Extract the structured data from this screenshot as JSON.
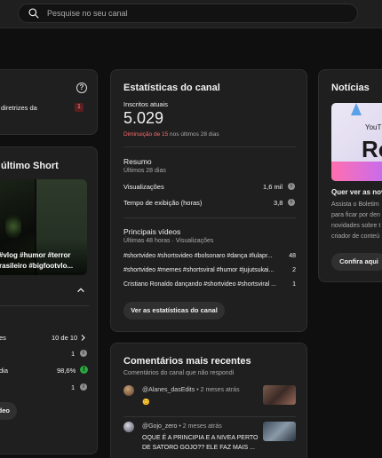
{
  "search": {
    "placeholder": "Pesquise no seu canal"
  },
  "left": {
    "policy_text": "diretrizes da",
    "policy_count": "1",
    "short_heading": "último Short",
    "short_caption_1": "#vlog #humor #terror",
    "short_caption_2": "rasileiro #bigfootvlo...",
    "stats": [
      {
        "label": "es",
        "value": "10 de 10"
      },
      {
        "label": "",
        "value": "1"
      },
      {
        "label": "dia",
        "value": "98,6%"
      },
      {
        "label": "",
        "value": "1"
      }
    ],
    "button": "deo"
  },
  "analytics": {
    "title": "Estatísticas do canal",
    "subs_label": "Inscritos atuais",
    "subs_value": "5.029",
    "decrease_prefix": "Diminuição de",
    "decrease_value": "15",
    "decrease_suffix": "nos últimos 28 dias",
    "summary_title": "Resumo",
    "summary_period": "Últimos 28 dias",
    "rows": [
      {
        "label": "Visualizações",
        "value": "1,6 mil"
      },
      {
        "label": "Tempo de exibição (horas)",
        "value": "3,8"
      }
    ],
    "top_title": "Principais vídeos",
    "top_period": "Últimas 48 horas · Visualizações",
    "videos": [
      {
        "title": "#shortvideo #shortsvideo #bolsonaro #dança #lulapr...",
        "views": "48"
      },
      {
        "title": "#shortvideo #memes #shortsviral #humor #jujutsukai...",
        "views": "2"
      },
      {
        "title": "Cristiano Ronaldo dançando #shortvideo #shortsviral ...",
        "views": "1"
      }
    ],
    "button": "Ver as estatísticas do canal"
  },
  "comments": {
    "title": "Comentários mais recentes",
    "subtitle": "Comentários do canal que não respondi",
    "items": [
      {
        "author": "@Alanes_dasEdits",
        "time": "• 2 meses atrás",
        "text": "😊",
        "text2": ""
      },
      {
        "author": "@Gojo_zero",
        "time": "• 2 meses atrás",
        "text": "OQUE É A PRINCIPIA E A NIVEA PERTO",
        "text2": "DE SATORO GOJO?? ELE FAZ MAIS ..."
      }
    ]
  },
  "news": {
    "title": "Notícias",
    "thumb_text_1": "YouT",
    "thumb_text_2": "Ro",
    "heading": "Quer ver as nov",
    "body": [
      "Assista o Boletim",
      "para ficar por den",
      "novidades sobre t",
      "criador de conteú"
    ],
    "button": "Confira aqui"
  }
}
